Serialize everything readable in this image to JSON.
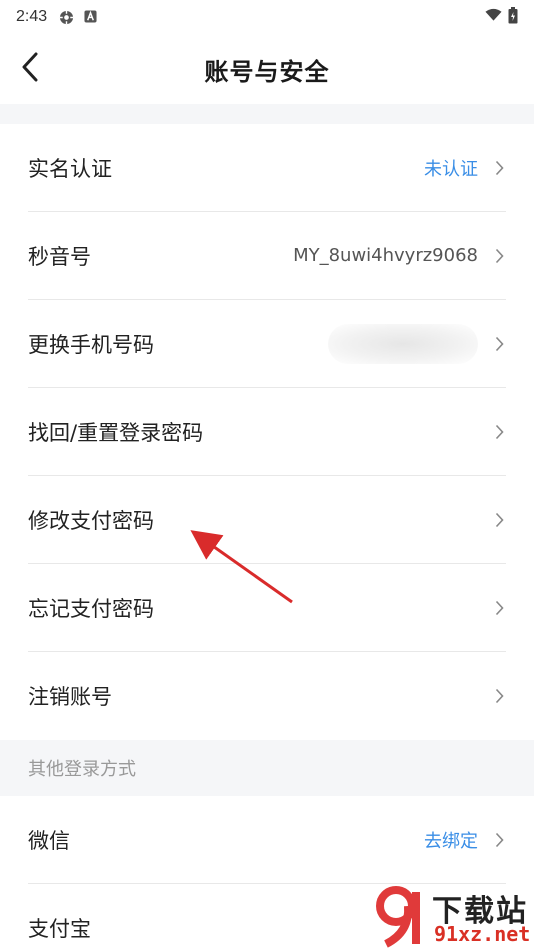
{
  "status_bar": {
    "time": "2:43",
    "icons_left": [
      "settings-icon",
      "text-badge-icon"
    ],
    "icons_right": [
      "wifi-icon",
      "battery-icon"
    ]
  },
  "nav": {
    "title": "账号与安全",
    "back_icon": "chevron-left-icon"
  },
  "account_items": [
    {
      "label": "实名认证",
      "value": "未认证",
      "value_color": "#3a8ee6"
    },
    {
      "label": "秒音号",
      "value": "MY_8uwi4hvyrz9068"
    },
    {
      "label": "更换手机号码",
      "value_blurred": true
    },
    {
      "label": "找回/重置登录密码"
    },
    {
      "label": "修改支付密码"
    },
    {
      "label": "忘记支付密码"
    },
    {
      "label": "注销账号"
    }
  ],
  "other_login": {
    "header": "其他登录方式",
    "items": [
      {
        "label": "微信",
        "value": "去绑定",
        "value_color": "#3a8ee6"
      },
      {
        "label": "支付宝"
      }
    ]
  },
  "watermark": {
    "line1": "下载站",
    "line2": "91xz.net"
  },
  "colors": {
    "accent": "#3a8ee6",
    "annotation_arrow": "#d92b2b",
    "section_bg": "#f5f6f8"
  }
}
